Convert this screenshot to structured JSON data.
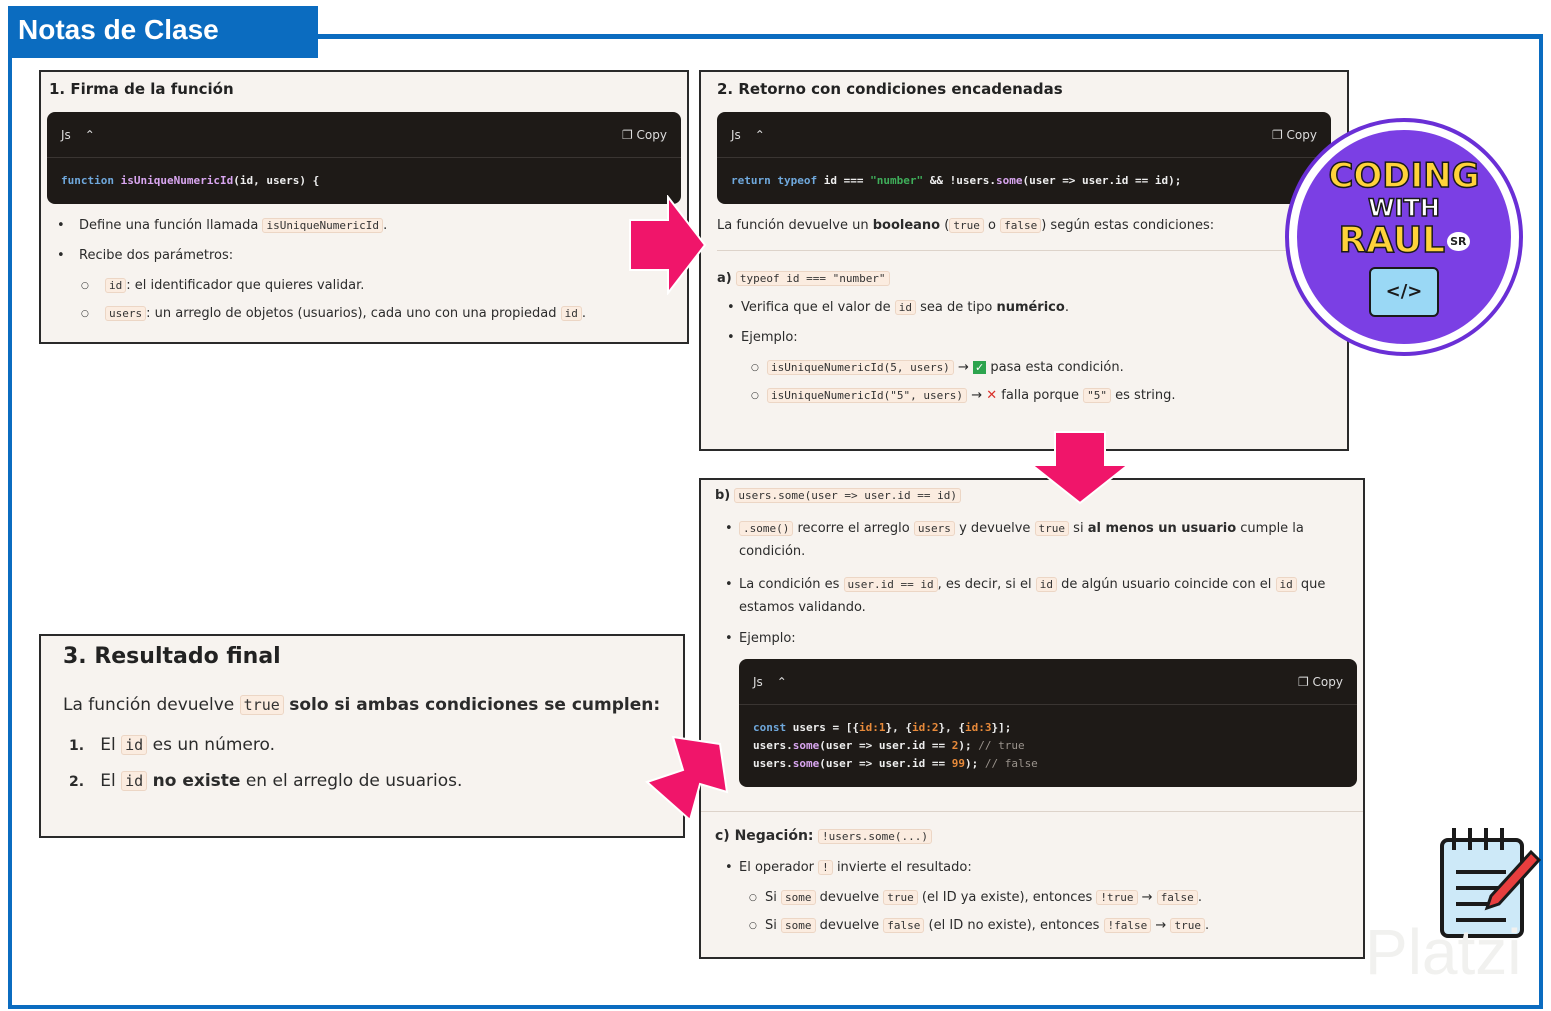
{
  "header": {
    "title": "Notas de Clase"
  },
  "section1": {
    "title": "1. Firma de la función",
    "code": {
      "lang": "Js",
      "copy": "Copy",
      "kw": "function",
      "fn": "isUniqueNumericId",
      "rest": "(id, users) {"
    },
    "b1": "Define una función llamada",
    "b1code": "isUniqueNumericId",
    "b1end": ".",
    "b2": "Recibe dos parámetros:",
    "s1code": "id",
    "s1": ": el identificador que quieres validar.",
    "s2code": "users",
    "s2": ": un arreglo de objetos (usuarios), cada uno con una propiedad",
    "s2code2": "id",
    "s2end": "."
  },
  "section2": {
    "title": "2. Retorno con condiciones encadenadas",
    "code": {
      "lang": "Js",
      "copy": "Copy",
      "k1": "return",
      "k2": "typeof",
      "t1": " id === ",
      "str": "\"number\"",
      "t2": " && !users.",
      "fn": "some",
      "t3": "(user => user.id == id);"
    },
    "intro1": "La función devuelve un",
    "intro_bold": "booleano",
    "intro2": "(",
    "c_true": "true",
    "o": "o",
    "c_false": "false",
    "intro3": ") según estas condiciones:",
    "a_label": "a)",
    "a_code": "typeof id === \"number\"",
    "a_b1": "Verifica que el valor de",
    "a_b1code": "id",
    "a_b1b": "sea de tipo",
    "a_b1bold": "numérico",
    "a_b1end": ".",
    "a_b2": "Ejemplo:",
    "ex1code": "isUniqueNumericId(5, users)",
    "ex1": "pasa esta condición.",
    "ex2code": "isUniqueNumericId(\"5\", users)",
    "ex2": "falla porque",
    "ex2code2": "\"5\"",
    "ex2end": "es string.",
    "arrow": "→"
  },
  "sectionB": {
    "label": "b)",
    "code_label": "users.some(user => user.id == id)",
    "b1code": ".some()",
    "b1a": "recorre el arreglo",
    "b1code2": "users",
    "b1b": "y devuelve",
    "b1code3": "true",
    "b1c": "si",
    "b1bold": "al menos un usuario",
    "b1d": "cumple la condición.",
    "b2a": "La condición es",
    "b2code": "user.id == id",
    "b2b": ", es decir, si el",
    "b2code2": "id",
    "b2c": "de algún usuario coincide con el",
    "b2code3": "id",
    "b2d": "que estamos validando.",
    "b3": "Ejemplo:",
    "code": {
      "lang": "Js",
      "copy": "Copy"
    },
    "c_label": "c) Negación:",
    "c_code": "!users.some(...)",
    "c_b1": "El operador",
    "c_b1code": "!",
    "c_b1b": "invierte el resultado:",
    "s1a": "Si",
    "s1c1": "some",
    "s1b": "devuelve",
    "s1c2": "true",
    "s1d": "(el ID ya existe), entonces",
    "s1c3": "!true",
    "s1c4": "false",
    "s2a": "Si",
    "s2c1": "some",
    "s2b": "devuelve",
    "s2c2": "false",
    "s2d": "(el ID no existe), entonces",
    "s2c3": "!false",
    "s2c4": "true",
    "arrow": "→",
    "dot": "."
  },
  "section3": {
    "title": "3. Resultado final",
    "intro": "La función devuelve",
    "code": "true",
    "intro_bold": "solo si ambas condiciones se cumplen:",
    "i1n": "1.",
    "i1a": "El",
    "i1code": "id",
    "i1b": "es un número.",
    "i2n": "2.",
    "i2a": "El",
    "i2code": "id",
    "i2bold": "no existe",
    "i2b": "en el arreglo de usuarios."
  },
  "logo": {
    "line1": "CODING",
    "line2": "WITH",
    "line3": "RAUL",
    "badge": "SR"
  },
  "watermark": "Platzi",
  "colors": {
    "blue": "#0b6cc0",
    "arrow": "#f0156a",
    "purple": "#6a2fd6"
  }
}
